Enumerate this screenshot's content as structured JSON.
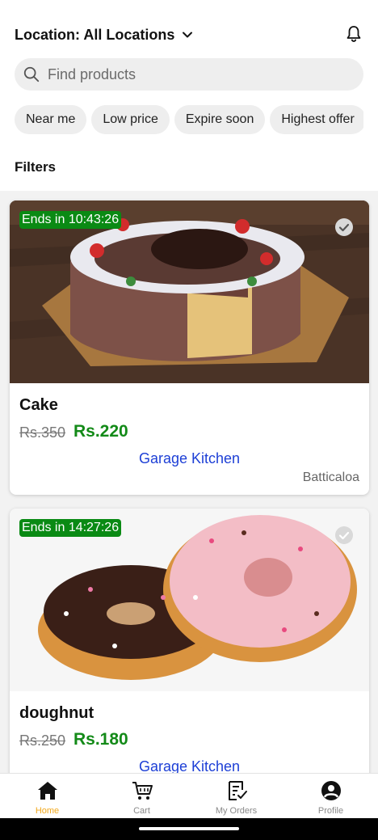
{
  "header": {
    "location_label": "Location: All Locations",
    "location_icon": "chevron-down-icon",
    "notification_icon": "bell-icon"
  },
  "search": {
    "placeholder": "Find products",
    "value": "",
    "icon": "search-icon"
  },
  "chips": [
    "Near me",
    "Low price",
    "Expire soon",
    "Highest offer"
  ],
  "filters_label": "Filters",
  "products": [
    {
      "timer": "Ends in 10:43:26",
      "name": "Cake",
      "old_price": "Rs.350",
      "new_price": "Rs.220",
      "store": "Garage Kitchen",
      "city": "Batticaloa",
      "selected_icon": "check-circle-icon",
      "image": "cake-image"
    },
    {
      "timer": "Ends in 14:27:26",
      "name": "doughnut",
      "old_price": "Rs.250",
      "new_price": "Rs.180",
      "store": "Garage Kitchen",
      "city": "",
      "selected_icon": "check-circle-icon",
      "image": "doughnut-image"
    }
  ],
  "bottom_nav": [
    {
      "label": "Home",
      "icon": "home-icon",
      "active": true
    },
    {
      "label": "Cart",
      "icon": "cart-icon",
      "active": false
    },
    {
      "label": "My Orders",
      "icon": "orders-icon",
      "active": false
    },
    {
      "label": "Profile",
      "icon": "profile-icon",
      "active": false
    }
  ],
  "colors": {
    "accent_active": "#f2a91d",
    "price_green": "#138a18",
    "timer_green": "#0a8a14",
    "store_link": "#1d3fd6"
  }
}
